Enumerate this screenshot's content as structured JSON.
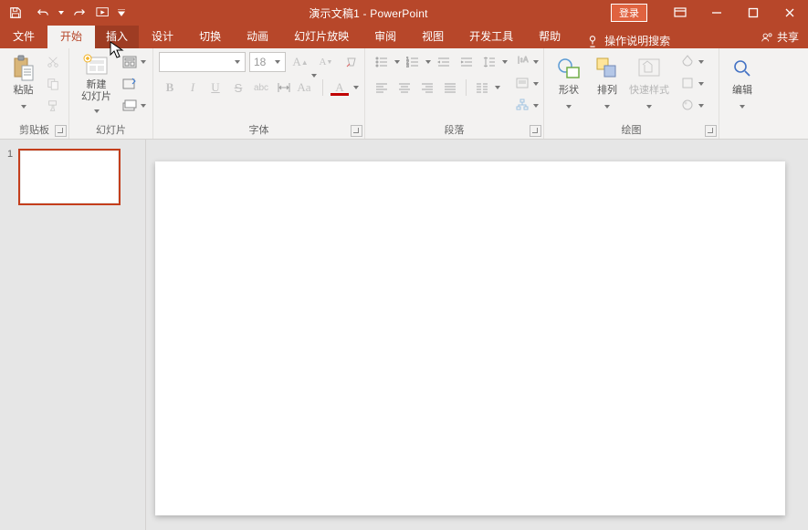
{
  "title": "演示文稿1  -  PowerPoint",
  "login": "登录",
  "share": "共享",
  "tabs": {
    "file": "文件",
    "home": "开始",
    "insert": "插入",
    "design": "设计",
    "transitions": "切换",
    "animations": "动画",
    "slideshow": "幻灯片放映",
    "review": "审阅",
    "view": "视图",
    "developer": "开发工具",
    "help": "帮助",
    "tellme": "操作说明搜索"
  },
  "groups": {
    "clipboard": "剪贴板",
    "slides": "幻灯片",
    "font": "字体",
    "paragraph": "段落",
    "drawing": "绘图",
    "editing": "编辑"
  },
  "cmd": {
    "paste": "粘贴",
    "newslide": "新建\n幻灯片",
    "shapes": "形状",
    "arrange": "排列",
    "quickstyles": "快速样式",
    "edit": "编辑"
  },
  "font": {
    "name": "",
    "size": "18"
  },
  "thumbs": {
    "slide1_num": "1"
  }
}
